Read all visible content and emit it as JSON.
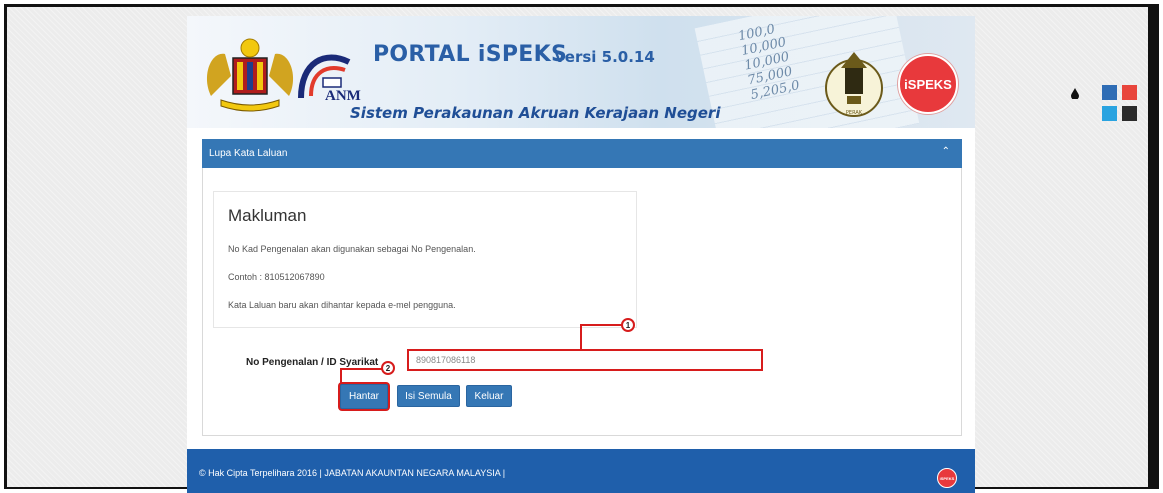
{
  "header": {
    "title": "PORTAL iSPEKS",
    "version": "versi 5.0.14",
    "subtitle": "Sistem Perakaunan Akruan Kerajaan Negeri",
    "anm_text": "ANM",
    "ispeks_logo_text": "iSPEKS",
    "perak_text": "PERAK",
    "bg_numbers": [
      "100,0",
      "10,000",
      "10,000",
      "75,000",
      "5,205,0"
    ]
  },
  "panel": {
    "title": "Lupa Kata Laluan",
    "collapse_icon": "chevron-up-icon"
  },
  "notice": {
    "title": "Makluman",
    "lines": [
      "No Kad Pengenalan akan digunakan sebagai No Pengenalan.",
      "Contoh : 810512067890",
      "Kata Laluan baru akan dihantar kepada e-mel pengguna."
    ]
  },
  "form": {
    "id_label": "No Pengenalan / ID Syarikat",
    "id_value": "890817086118",
    "buttons": {
      "submit": "Hantar",
      "reset": "Isi Semula",
      "exit": "Keluar"
    }
  },
  "callouts": [
    "1",
    "2"
  ],
  "footer": {
    "text": "© Hak Cipta Terpelihara 2016 | JABATAN AKAUNTAN NEGARA MALAYSIA |",
    "logo_text": "iSPEKS"
  },
  "theme_switcher": {
    "icon": "drop-icon",
    "colors": [
      "#2f6db5",
      "#e8453c",
      "#29a3e0",
      "#2b2b2b"
    ]
  }
}
